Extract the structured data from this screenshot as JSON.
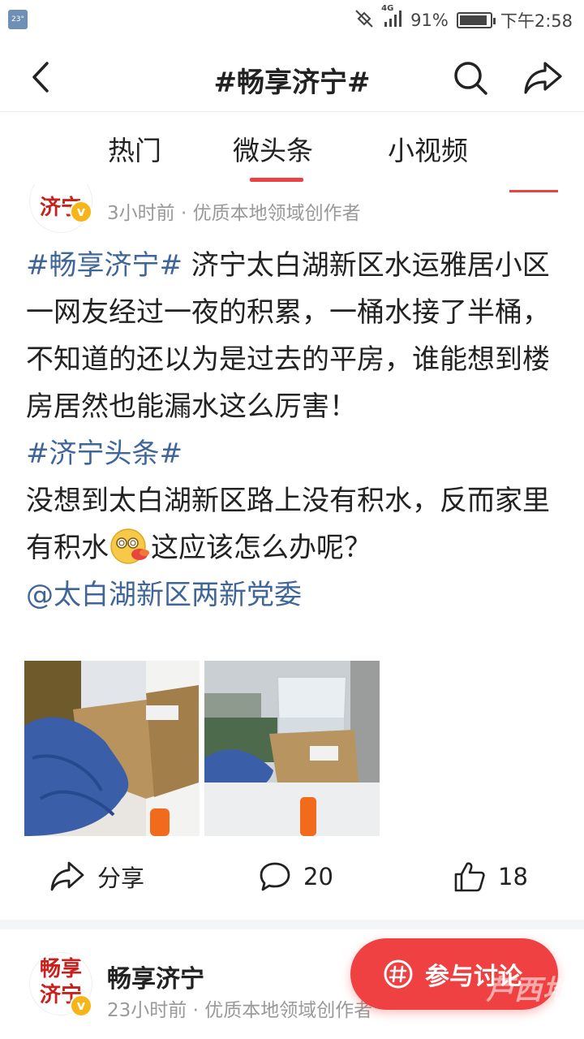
{
  "status_bar": {
    "thumb_text": "23°",
    "network": "4G",
    "battery": "91%",
    "battery_level": 0.91,
    "time": "下午2:58"
  },
  "header": {
    "title": "#畅享济宁#"
  },
  "tabs": [
    {
      "label": "热门",
      "active": false
    },
    {
      "label": "微头条",
      "active": true
    },
    {
      "label": "小视频",
      "active": false
    }
  ],
  "post1": {
    "avatar_text": [
      "济宁"
    ],
    "meta": "3小时前 · 优质本地领域创作者",
    "body": [
      {
        "hashtag": "#畅享济宁#",
        "text": " 济宁太白湖新区水运雅居小区一网友经过一夜的积累，一桶水接了半桶，不知道的还以为是过去的平房，谁能想到楼房居然也能漏水这么厉害！"
      },
      {
        "hashtag": "#济宁头条#"
      },
      {
        "text_before_emoji": "没想到太白湖新区路上没有积水，反而家里有积水",
        "text_after_emoji": "这应该怎么办呢？"
      },
      {
        "mention": "@太白湖新区两新党委"
      }
    ],
    "actions": {
      "share_label": "分享",
      "comment_count": "20",
      "like_count": "18"
    }
  },
  "post2": {
    "avatar_text": [
      "畅享",
      "济宁"
    ],
    "author": "畅享济宁",
    "meta": "23小时前 · 优质本地领域创作者"
  },
  "fab": {
    "label": "参与讨论"
  },
  "watermark": "芦西地",
  "colors": {
    "accent_red": "#f04142",
    "link_blue": "#406599",
    "meta_gray": "#999999",
    "badge_gold": "#f6b619"
  }
}
